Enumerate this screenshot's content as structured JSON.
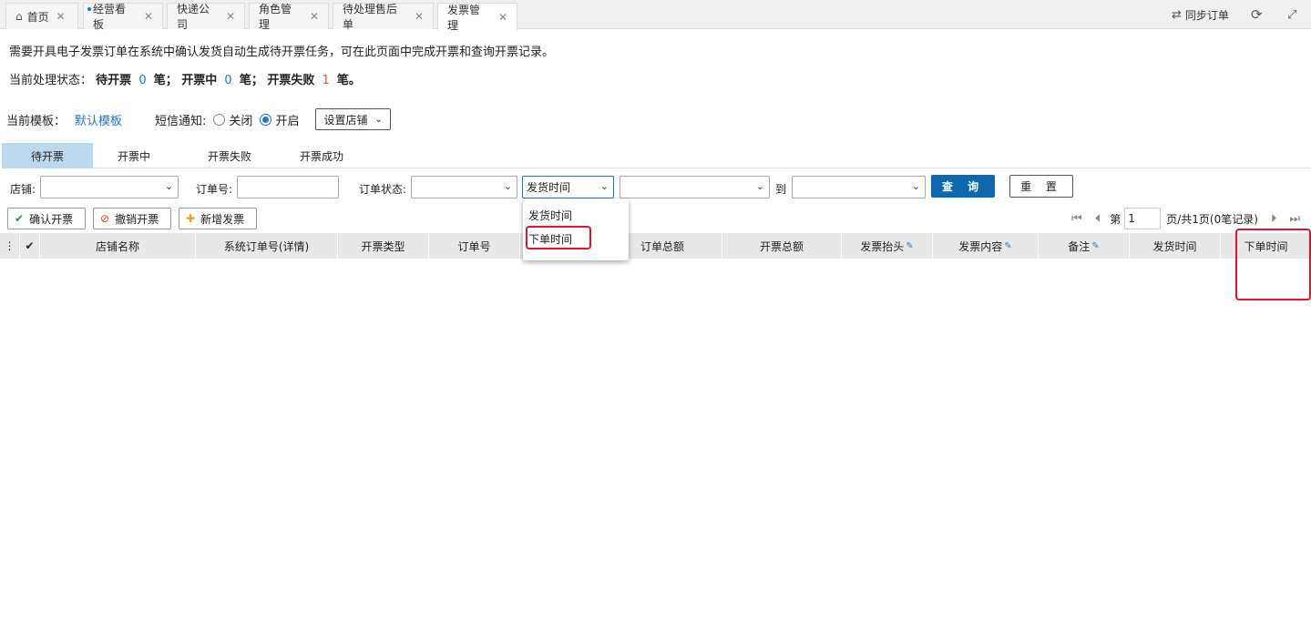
{
  "tabs": [
    {
      "label": "首页",
      "icon": "home-icon"
    },
    {
      "label": "经营看板"
    },
    {
      "label": "快递公司"
    },
    {
      "label": "角色管理"
    },
    {
      "label": "待处理售后单"
    },
    {
      "label": "发票管理",
      "active": true
    }
  ],
  "topbar": {
    "sync_label": "同步订单"
  },
  "intro": "需要开具电子发票订单在系统中确认发货自动生成待开票任务，可在此页面中完成开票和查询开票记录。",
  "status": {
    "prefix": "当前处理状态：",
    "pending_label": "待开票",
    "pending_count": "0",
    "in_progress_label": "笔；  开票中",
    "in_progress_count": "0",
    "failed_label": "笔；  开票失败",
    "failed_count": "1",
    "suffix": "笔。"
  },
  "template": {
    "label": "当前模板：",
    "value": "默认模板",
    "sms_label": "短信通知:",
    "sms_off": "关闭",
    "sms_on": "开启",
    "sms_selected": "开启",
    "shop_button": "设置店铺"
  },
  "subtabs": [
    "待开票",
    "开票中",
    "开票失败",
    "开票成功"
  ],
  "filters": {
    "shop_label": "店铺:",
    "order_no_label": "订单号:",
    "order_status_label": "订单状态:",
    "time_type_value": "发货时间",
    "to_label": "到",
    "query_button": "查 询",
    "reset_button": "重 置"
  },
  "dropdown": {
    "options": [
      "发货时间",
      "下单时间"
    ],
    "highlighted": "下单时间"
  },
  "actions": {
    "confirm": "确认开票",
    "cancel": "撤销开票",
    "add": "新增发票"
  },
  "pager": {
    "prefix": "第",
    "page": "1",
    "suffix": "页/共1页(0笔记录)"
  },
  "columns": [
    "店铺名称",
    "系统订单号(详情)",
    "开票类型",
    "订单号",
    "订单总额",
    "开票总额",
    "发票抬头",
    "发票内容",
    "备注",
    "发货时间",
    "下单时间"
  ],
  "colors": {
    "accent": "#1e78c2",
    "primary_button": "#0e68ad",
    "highlight_box": "#e8102a",
    "active_subtab": "#bcd8ee"
  }
}
